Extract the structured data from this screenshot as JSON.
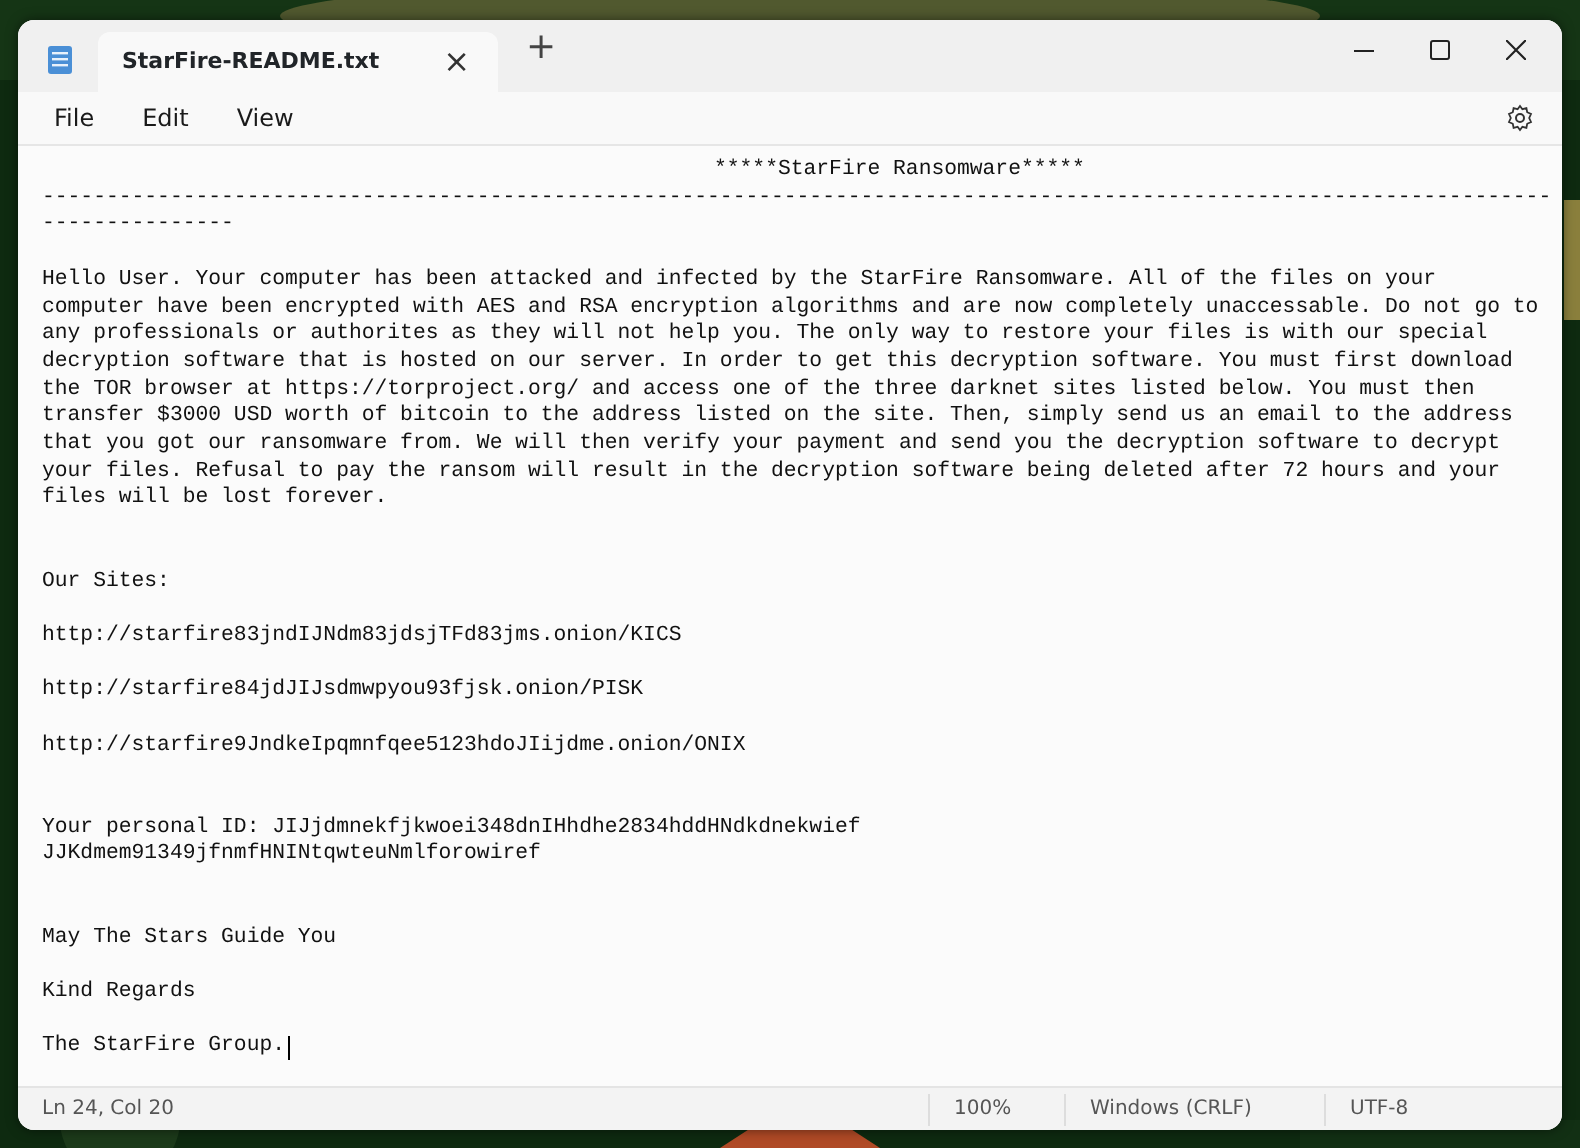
{
  "window": {
    "tab_title": "StarFire-README.txt",
    "tab_close": "×",
    "new_tab": "+"
  },
  "menu": [
    "File",
    "Edit",
    "View"
  ],
  "document": [
    {
      "kind": "heading",
      "lines": [
        "*****StarFire Ransomware*****"
      ]
    },
    {
      "kind": "rule",
      "lines": [
        "----------------------------------------------------------------------------------------------------------------------",
        "---------------"
      ]
    },
    {
      "kind": "text",
      "lines": [
        "Hello User. Your computer has been attacked and infected by the StarFire Ransomware. All of the files on your",
        "computer have been encrypted with AES and RSA encryption algorithms and are now completely unaccessable. Do not go to",
        "any professionals or authorites as they will not help you. The only way to restore your files is with our special",
        "decryption software that is hosted on our server. In order to get this decryption software. You must first download",
        "the TOR browser at https://torproject.org/ and access one of the three darknet sites listed below. You must then",
        "transfer $3000 USD worth of bitcoin to the address listed on the site. Then, simply send us an email to the address",
        "that you got our ransomware from. We will then verify your payment and send you the decryption software to decrypt",
        "your files. Refusal to pay the ransom will result in the decryption software being deleted after 72 hours and your",
        "files will be lost forever."
      ]
    },
    {
      "kind": "section",
      "lines": [
        "Our Sites:"
      ]
    },
    {
      "kind": "text",
      "lines": [
        "http://starfire83jndIJNdm83jdsjTFd83jms.onion/KICS"
      ]
    },
    {
      "kind": "text",
      "lines": [
        "http://starfire84jdJIJsdmwpyou93fjsk.onion/PISK"
      ]
    },
    {
      "kind": "text",
      "lines": [
        "http://starfire9JndkeIpqmnfqee5123hdoJIijdme.onion/ONIX"
      ]
    },
    {
      "kind": "section",
      "lines": [
        "Your personal ID: JIJjdmnekfjkwoei348dnIHhdhe2834hddHNdkdnekwief",
        "JJKdmem91349jfnmfHNINtqwteuNmlforowiref"
      ]
    },
    {
      "kind": "section",
      "lines": [
        "May The Stars Guide You"
      ]
    },
    {
      "kind": "text",
      "lines": [
        "Kind Regards"
      ]
    },
    {
      "kind": "text",
      "lines": [
        "The StarFire Group."
      ],
      "caret": true
    }
  ],
  "status_bar": [
    "Ln 24, Col 20",
    "100%",
    "Windows (CRLF)",
    "UTF-8"
  ]
}
